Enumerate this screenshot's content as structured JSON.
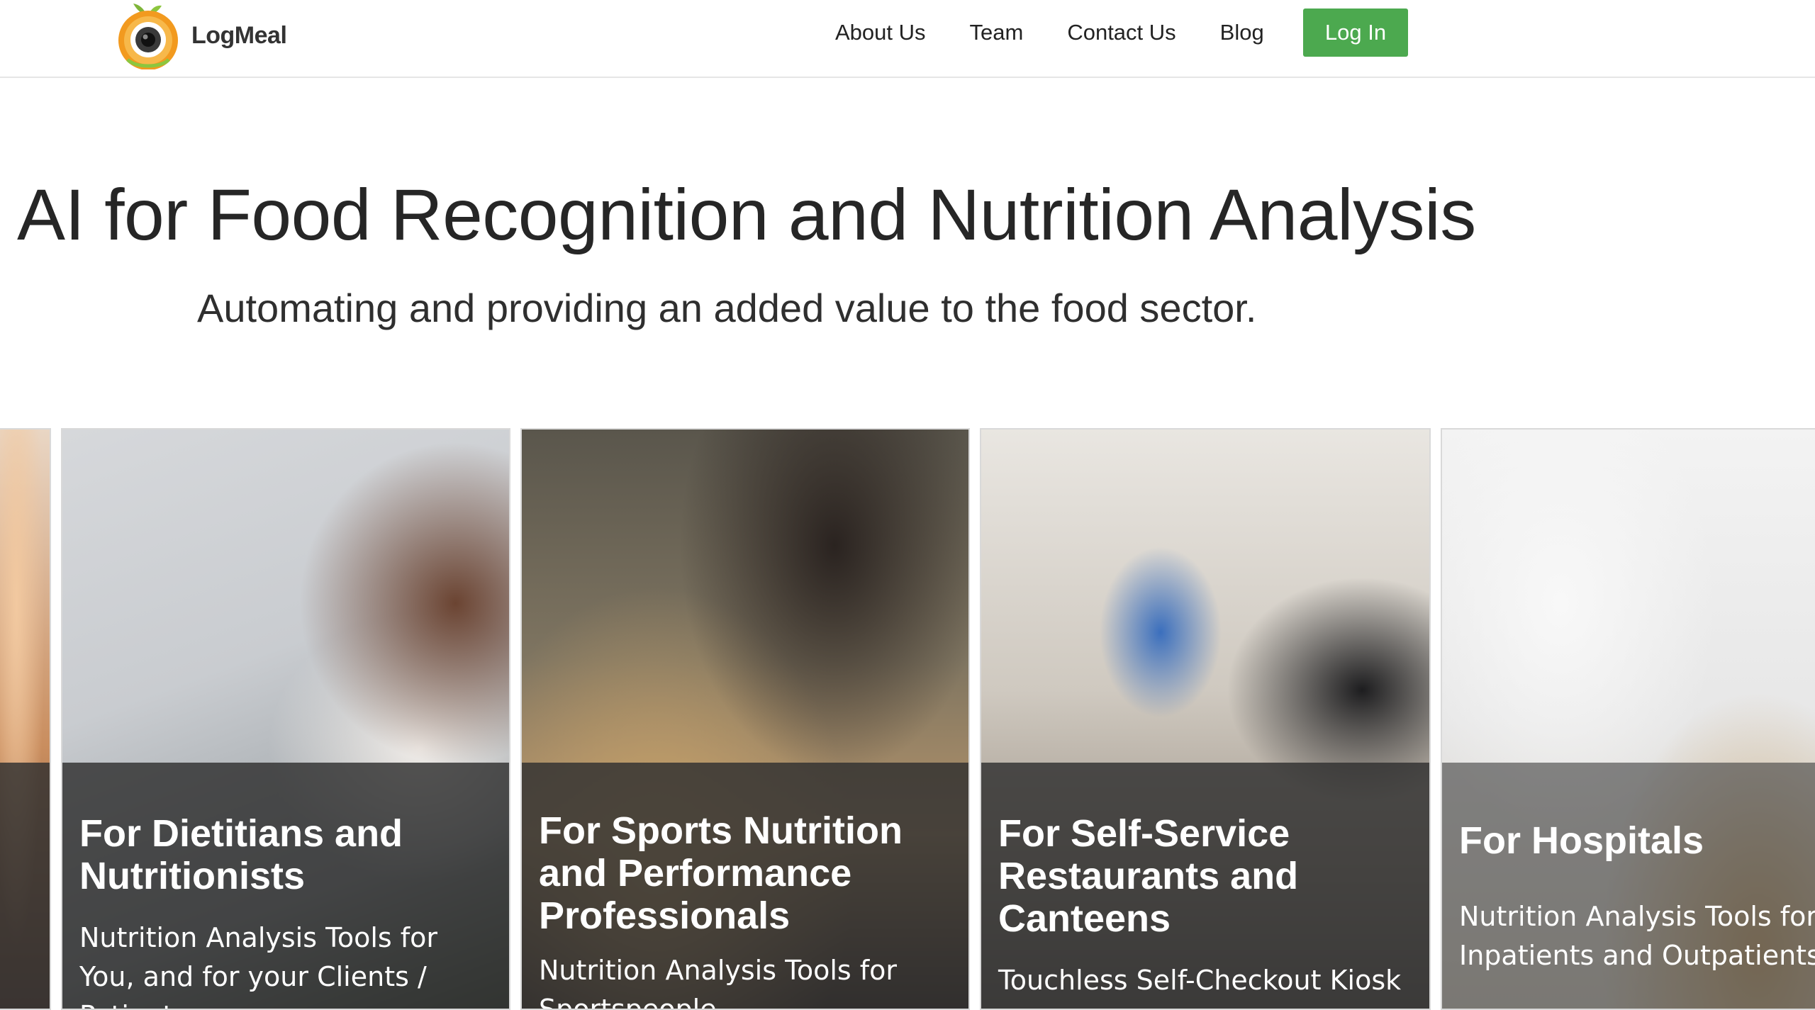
{
  "brand": {
    "name": "LogMeal"
  },
  "nav": {
    "items": [
      "About Us",
      "Team",
      "Contact Us",
      "Blog"
    ],
    "login_label": "Log In"
  },
  "hero": {
    "title": "AI for Food Recognition and Nutrition Analysis",
    "subtitle": "Automating and providing an added value to the food sector."
  },
  "cards": [
    {
      "title": "For Dietitians and Nutritionists",
      "description": "Nutrition Analysis Tools for You, and for your Clients / Patients"
    },
    {
      "title": "For Sports Nutrition and Performance Professionals",
      "description": "Nutrition Analysis Tools for Sportspeople"
    },
    {
      "title": "For Self-Service Restaurants and Canteens",
      "description": "Touchless Self-Checkout Kiosk"
    },
    {
      "title": "For Hospitals",
      "description": "Nutrition Analysis Tools for Inpatients and Outpatients"
    }
  ],
  "colors": {
    "accent": "#4ca94f",
    "card_overlay": "#303030"
  },
  "icons": {
    "logo": "camera-apple-logo-icon"
  }
}
